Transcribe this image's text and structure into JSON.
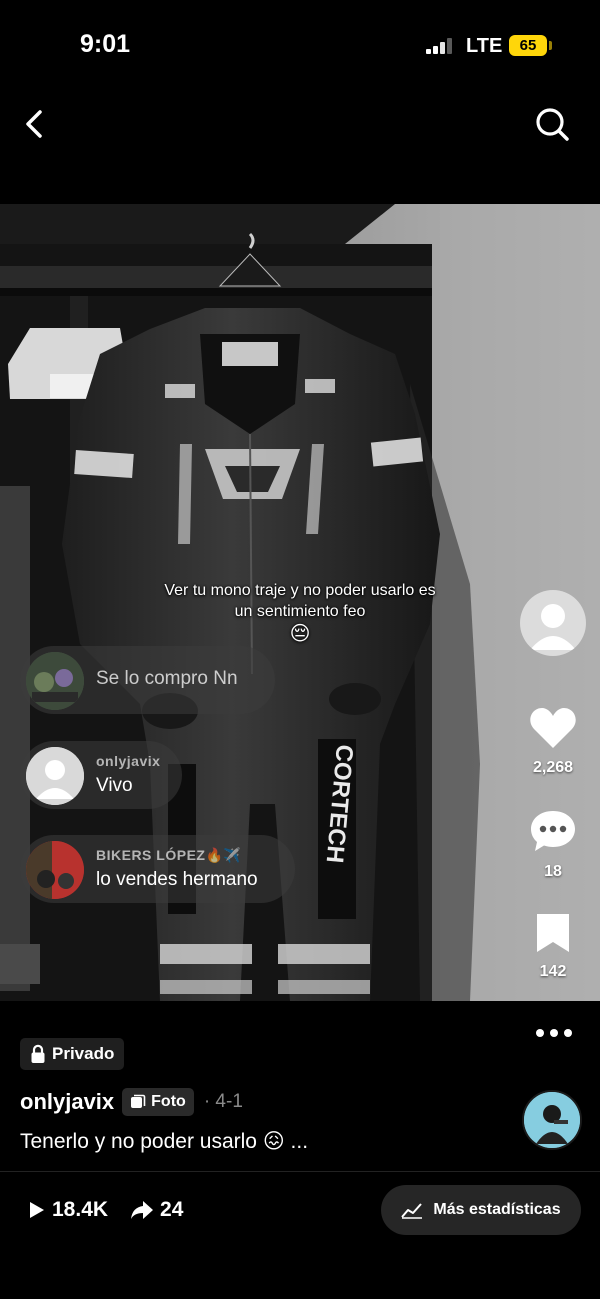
{
  "status_bar": {
    "time": "9:01",
    "network": "LTE",
    "battery": "65"
  },
  "post": {
    "overlay_caption": "Ver tu mono traje y no poder usarlo es un sentimiento feo",
    "overlay_emoji": "😔",
    "brand_text": "CORTECH"
  },
  "comments": [
    {
      "author": "",
      "text": "Se lo compro Nn"
    },
    {
      "author": "onlyjavix",
      "text": "Vivo"
    },
    {
      "author": "BIKERS LÓPEZ🔥✈️",
      "text": "lo vendes hermano"
    }
  ],
  "actions": {
    "likes": "2,268",
    "comments": "18",
    "saves": "142"
  },
  "info": {
    "privacy_label": "Privado",
    "username": "onlyjavix",
    "type_label": "Foto",
    "date": "· 4-1",
    "description": "Tenerlo y no poder usarlo 😖 ..."
  },
  "stats": {
    "views": "18.4K",
    "shares": "24",
    "more_stats_label": "Más estadísticas"
  },
  "colors": {
    "background": "#000000",
    "battery": "#ffd60a",
    "chip": "#262626"
  }
}
